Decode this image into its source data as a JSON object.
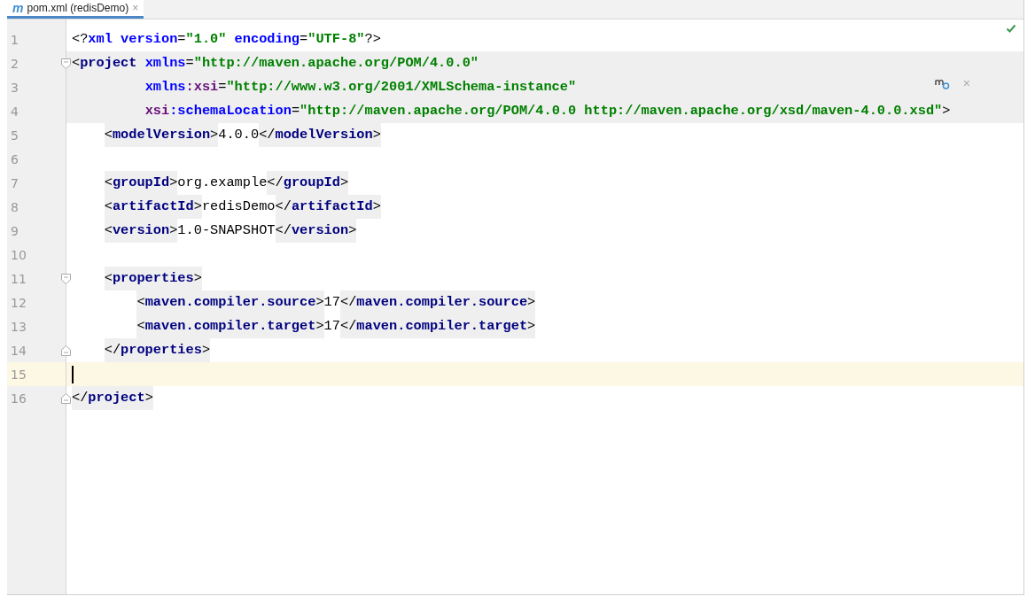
{
  "tab": {
    "icon_letter": "m",
    "title": "pom.xml (redisDemo)",
    "close": "×",
    "selected": true
  },
  "editor": {
    "status_ok": true,
    "notification": {
      "close": "×"
    },
    "lines": [
      {
        "number": "1",
        "current": false,
        "highlighted": false,
        "fold_start": false,
        "fold_end": false,
        "tokens": [
          {
            "kind": "punct",
            "text": "<?",
            "hl": false
          },
          {
            "kind": "attr",
            "text": "xml version",
            "hl": false
          },
          {
            "kind": "punct",
            "text": "=",
            "hl": false
          },
          {
            "kind": "value",
            "text": "\"1.0\"",
            "hl": false
          },
          {
            "kind": "attr",
            "text": " encoding",
            "hl": false
          },
          {
            "kind": "punct",
            "text": "=",
            "hl": false
          },
          {
            "kind": "value",
            "text": "\"UTF-8\"",
            "hl": false
          },
          {
            "kind": "punct",
            "text": "?>",
            "hl": false
          }
        ]
      },
      {
        "number": "2",
        "current": false,
        "highlighted": true,
        "fold_start": true,
        "fold_end": false,
        "tokens": [
          {
            "kind": "punct",
            "text": "<"
          },
          {
            "kind": "tag",
            "text": "project"
          },
          {
            "kind": "attr",
            "text": " xmlns"
          },
          {
            "kind": "punct",
            "text": "="
          },
          {
            "kind": "value",
            "text": "\"http://maven.apache.org/POM/4.0.0\""
          }
        ]
      },
      {
        "number": "3",
        "current": false,
        "highlighted": true,
        "fold_start": false,
        "fold_end": false,
        "tokens": [
          {
            "kind": "attr",
            "text": "         xmlns"
          },
          {
            "kind": "ns",
            "text": ":xsi"
          },
          {
            "kind": "punct",
            "text": "="
          },
          {
            "kind": "value",
            "text": "\"http://www.w3.org/2001/XMLSchema-instance\""
          }
        ]
      },
      {
        "number": "4",
        "current": false,
        "highlighted": true,
        "fold_start": false,
        "fold_end": false,
        "tokens": [
          {
            "kind": "ns",
            "text": "         xsi"
          },
          {
            "kind": "attr",
            "text": ":schemaLocation"
          },
          {
            "kind": "punct",
            "text": "="
          },
          {
            "kind": "value",
            "text": "\"http://maven.apache.org/POM/4.0.0 http://maven.apache.org/xsd/maven-4.0.0.xsd\""
          },
          {
            "kind": "punct",
            "text": ">"
          }
        ]
      },
      {
        "number": "5",
        "current": false,
        "highlighted": false,
        "fold_start": false,
        "fold_end": false,
        "tokens": [
          {
            "kind": "punct",
            "text": "    <",
            "hl": true
          },
          {
            "kind": "tag",
            "text": "modelVersion",
            "hl": true
          },
          {
            "kind": "punct",
            "text": ">",
            "hl": true
          },
          {
            "kind": "text",
            "text": "4.0.0",
            "hl": false
          },
          {
            "kind": "punct",
            "text": "</",
            "hl": true
          },
          {
            "kind": "tag",
            "text": "modelVersion",
            "hl": true
          },
          {
            "kind": "punct",
            "text": ">",
            "hl": true
          }
        ]
      },
      {
        "number": "6",
        "current": false,
        "highlighted": false,
        "fold_start": false,
        "fold_end": false
      },
      {
        "number": "7",
        "current": false,
        "highlighted": false,
        "fold_start": false,
        "fold_end": false,
        "tokens": [
          {
            "kind": "punct",
            "text": "    <",
            "hl": true
          },
          {
            "kind": "tag",
            "text": "groupId",
            "hl": true
          },
          {
            "kind": "punct",
            "text": ">",
            "hl": true
          },
          {
            "kind": "text",
            "text": "org.example",
            "hl": false
          },
          {
            "kind": "punct",
            "text": "</",
            "hl": true
          },
          {
            "kind": "tag",
            "text": "groupId",
            "hl": true
          },
          {
            "kind": "punct",
            "text": ">",
            "hl": true
          }
        ]
      },
      {
        "number": "8",
        "current": false,
        "highlighted": false,
        "fold_start": false,
        "fold_end": false,
        "tokens": [
          {
            "kind": "punct",
            "text": "    <",
            "hl": true
          },
          {
            "kind": "tag",
            "text": "artifactId",
            "hl": true
          },
          {
            "kind": "punct",
            "text": ">",
            "hl": true
          },
          {
            "kind": "text",
            "text": "redisDemo",
            "hl": false
          },
          {
            "kind": "punct",
            "text": "</",
            "hl": true
          },
          {
            "kind": "tag",
            "text": "artifactId",
            "hl": true
          },
          {
            "kind": "punct",
            "text": ">",
            "hl": true
          }
        ]
      },
      {
        "number": "9",
        "current": false,
        "highlighted": false,
        "fold_start": false,
        "fold_end": false,
        "tokens": [
          {
            "kind": "punct",
            "text": "    <",
            "hl": true
          },
          {
            "kind": "tag",
            "text": "version",
            "hl": true
          },
          {
            "kind": "punct",
            "text": ">",
            "hl": true
          },
          {
            "kind": "text",
            "text": "1.0-SNAPSHOT",
            "hl": false
          },
          {
            "kind": "punct",
            "text": "</",
            "hl": true
          },
          {
            "kind": "tag",
            "text": "version",
            "hl": true
          },
          {
            "kind": "punct",
            "text": ">",
            "hl": true
          }
        ]
      },
      {
        "number": "10",
        "current": false,
        "highlighted": false,
        "fold_start": false,
        "fold_end": false
      },
      {
        "number": "11",
        "current": false,
        "highlighted": false,
        "fold_start": true,
        "fold_end": false,
        "tokens": [
          {
            "kind": "punct",
            "text": "    <",
            "hl": true
          },
          {
            "kind": "tag",
            "text": "properties",
            "hl": true
          },
          {
            "kind": "punct",
            "text": ">",
            "hl": true
          }
        ]
      },
      {
        "number": "12",
        "current": false,
        "highlighted": false,
        "fold_start": false,
        "fold_end": false,
        "tokens": [
          {
            "kind": "punct",
            "text": "        <",
            "hl": true
          },
          {
            "kind": "tag",
            "text": "maven.compiler.source",
            "hl": true
          },
          {
            "kind": "punct",
            "text": ">",
            "hl": true
          },
          {
            "kind": "text",
            "text": "17",
            "hl": false
          },
          {
            "kind": "punct",
            "text": "</",
            "hl": true
          },
          {
            "kind": "tag",
            "text": "maven.compiler.source",
            "hl": true
          },
          {
            "kind": "punct",
            "text": ">",
            "hl": true
          }
        ]
      },
      {
        "number": "13",
        "current": false,
        "highlighted": false,
        "fold_start": false,
        "fold_end": false,
        "tokens": [
          {
            "kind": "punct",
            "text": "        <",
            "hl": true
          },
          {
            "kind": "tag",
            "text": "maven.compiler.target",
            "hl": true
          },
          {
            "kind": "punct",
            "text": ">",
            "hl": true
          },
          {
            "kind": "text",
            "text": "17",
            "hl": false
          },
          {
            "kind": "punct",
            "text": "</",
            "hl": true
          },
          {
            "kind": "tag",
            "text": "maven.compiler.target",
            "hl": true
          },
          {
            "kind": "punct",
            "text": ">",
            "hl": true
          }
        ]
      },
      {
        "number": "14",
        "current": false,
        "highlighted": false,
        "fold_start": false,
        "fold_end": true,
        "tokens": [
          {
            "kind": "punct",
            "text": "    </",
            "hl": true
          },
          {
            "kind": "tag",
            "text": "properties",
            "hl": true
          },
          {
            "kind": "punct",
            "text": ">",
            "hl": true
          }
        ]
      },
      {
        "number": "15",
        "current": true,
        "highlighted": false,
        "fold_start": false,
        "fold_end": false
      },
      {
        "number": "16",
        "current": false,
        "highlighted": false,
        "fold_start": false,
        "fold_end": true,
        "tokens": [
          {
            "kind": "punct",
            "text": "</",
            "hl": true
          },
          {
            "kind": "tag",
            "text": "project",
            "hl": true
          },
          {
            "kind": "punct",
            "text": ">",
            "hl": true
          }
        ]
      }
    ]
  }
}
